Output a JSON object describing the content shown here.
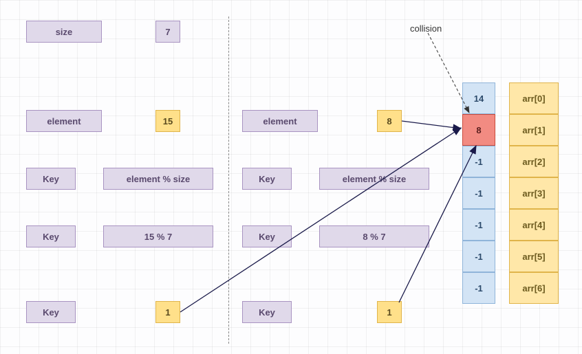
{
  "top": {
    "size_label": "size",
    "size_value": "7",
    "collision_label": "collision"
  },
  "left": {
    "element_label": "element",
    "element_value": "15",
    "key_label": "Key",
    "expr1": "element % size",
    "expr2": "15 % 7",
    "result": "1"
  },
  "right": {
    "element_label": "element",
    "element_value": "8",
    "key_label": "Key",
    "expr1": "element % size",
    "expr2": "8 % 7",
    "result": "1"
  },
  "arr": {
    "cells": [
      "14",
      "8",
      "-1",
      "-1",
      "-1",
      "-1",
      "-1"
    ],
    "labels": [
      "arr[0]",
      "arr[1]",
      "arr[2]",
      "arr[3]",
      "arr[4]",
      "arr[5]",
      "arr[6]"
    ]
  }
}
